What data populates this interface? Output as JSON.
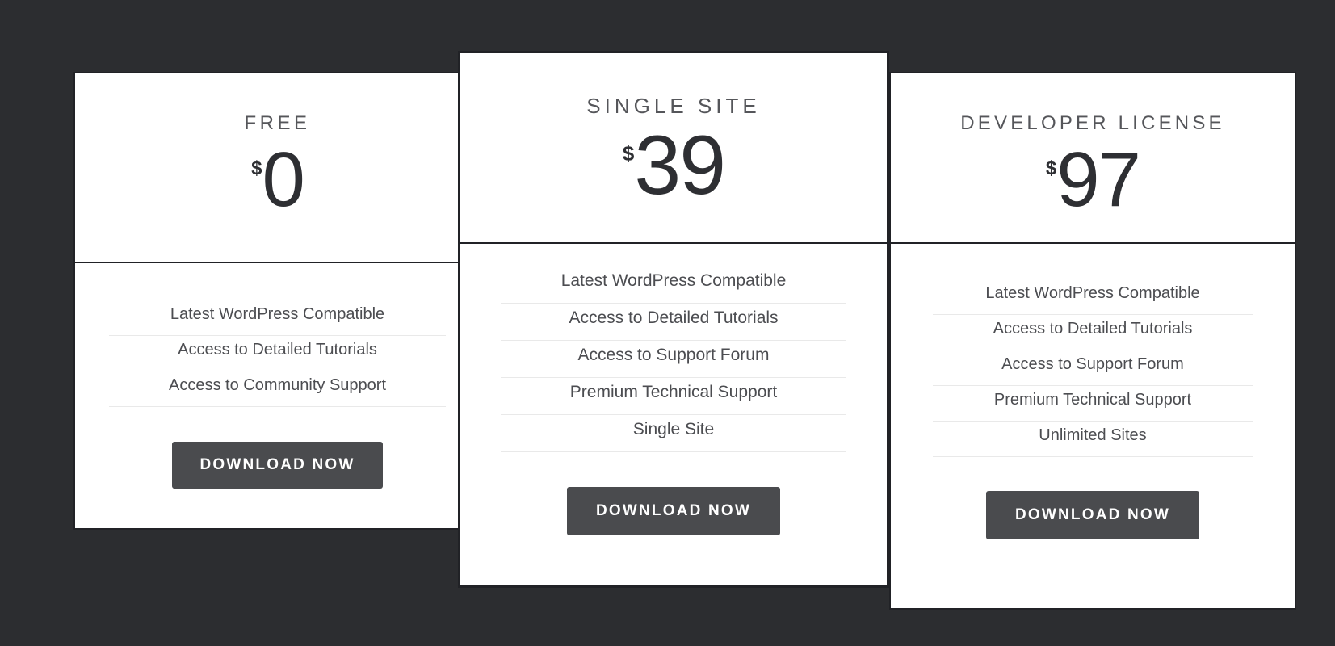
{
  "page": {
    "background_color": "#2c2d30",
    "card_background_color": "#ffffff",
    "card_border_color": "#212226",
    "divider_color": "#e9e9e9",
    "button_color": "#4a4b4e",
    "button_text_color": "#ffffff",
    "text_color": "#4c4d51"
  },
  "plans": [
    {
      "id": "free",
      "name": "FREE",
      "currency": "$",
      "price": "0",
      "features": [
        "Latest WordPress Compatible",
        "Access to Detailed Tutorials",
        "Access to Community Support"
      ],
      "cta_label": "DOWNLOAD NOW"
    },
    {
      "id": "single-site",
      "name": "SINGLE SITE",
      "currency": "$",
      "price": "39",
      "featured": true,
      "features": [
        "Latest WordPress Compatible",
        "Access to Detailed Tutorials",
        "Access to Support Forum",
        "Premium Technical Support",
        "Single Site"
      ],
      "cta_label": "DOWNLOAD NOW"
    },
    {
      "id": "developer-license",
      "name": "DEVELOPER LICENSE",
      "currency": "$",
      "price": "97",
      "features": [
        "Latest WordPress Compatible",
        "Access to Detailed Tutorials",
        "Access to Support Forum",
        "Premium Technical Support",
        "Unlimited Sites"
      ],
      "cta_label": "DOWNLOAD NOW"
    }
  ]
}
